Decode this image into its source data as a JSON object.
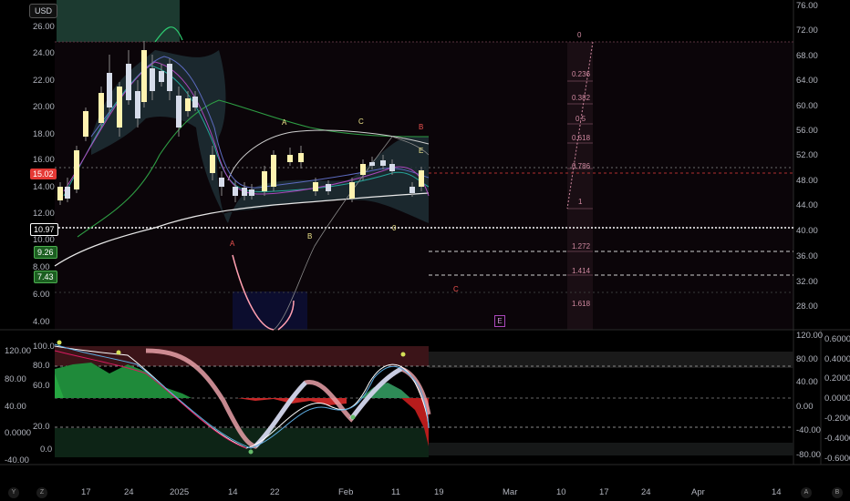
{
  "currency_button": "USD",
  "price_axis_left": [
    "26.00",
    "24.00",
    "22.00",
    "20.00",
    "18.00",
    "16.00",
    "14.00",
    "12.00",
    "10.00",
    "8.00",
    "6.00",
    "4.00"
  ],
  "price_axis_right": [
    "76.00",
    "72.00",
    "68.00",
    "64.00",
    "60.00",
    "56.00",
    "52.00",
    "48.00",
    "44.00",
    "40.00",
    "36.00",
    "32.00",
    "28.00"
  ],
  "price_tags": [
    {
      "label": "15.02",
      "color": "#e53935"
    },
    {
      "label": "10.97",
      "color": "#000000"
    },
    {
      "label": "9.26",
      "color": "#4caf50"
    },
    {
      "label": "7.43",
      "color": "#4caf50"
    }
  ],
  "fib_levels": [
    "0",
    "0.236",
    "0.382",
    "0.5",
    "0.618",
    "0.786",
    "1",
    "1.272",
    "1.414",
    "1.618"
  ],
  "wave_labels": [
    {
      "t": "A",
      "color": "#f0e68c"
    },
    {
      "t": "B",
      "color": "#f0e68c"
    },
    {
      "t": "C",
      "color": "#f0e68c"
    },
    {
      "t": "B",
      "color": "#ef5350"
    },
    {
      "t": "E",
      "color": "#f0e68c"
    },
    {
      "t": "A",
      "color": "#ef5350"
    },
    {
      "t": "0",
      "color": "#f0e68c"
    },
    {
      "t": "C",
      "color": "#ef5350"
    }
  ],
  "event_marker": "E",
  "osc_axis_left": [
    "120.00",
    "100.0",
    "80.00",
    "80.0",
    "60.0",
    "40.00",
    "20.0",
    "0.0000",
    "0.0",
    "-40.00"
  ],
  "osc_axis_mid": [
    "120.00",
    "80.00",
    "40.00",
    "0.00",
    "-40.00",
    "-80.00"
  ],
  "osc_axis_right": [
    "0.6000",
    "0.4000",
    "0.2000",
    "0.0000",
    "-0.2000",
    "-0.4000",
    "-0.6000"
  ],
  "time_axis": [
    "17",
    "24",
    "2025",
    "14",
    "22",
    "Feb",
    "11",
    "19",
    "Mar",
    "10",
    "17",
    "24",
    "Apr",
    "14"
  ],
  "corner_buttons": {
    "left": "Y",
    "mid": "Z",
    "right_a": "A",
    "right_b": "B"
  },
  "colors": {
    "up": "#fff3b0",
    "down": "#d6dcea",
    "bull_zone": "#1b3a2a",
    "bear_zone": "#3a0d12",
    "fib": "#d089a0"
  }
}
